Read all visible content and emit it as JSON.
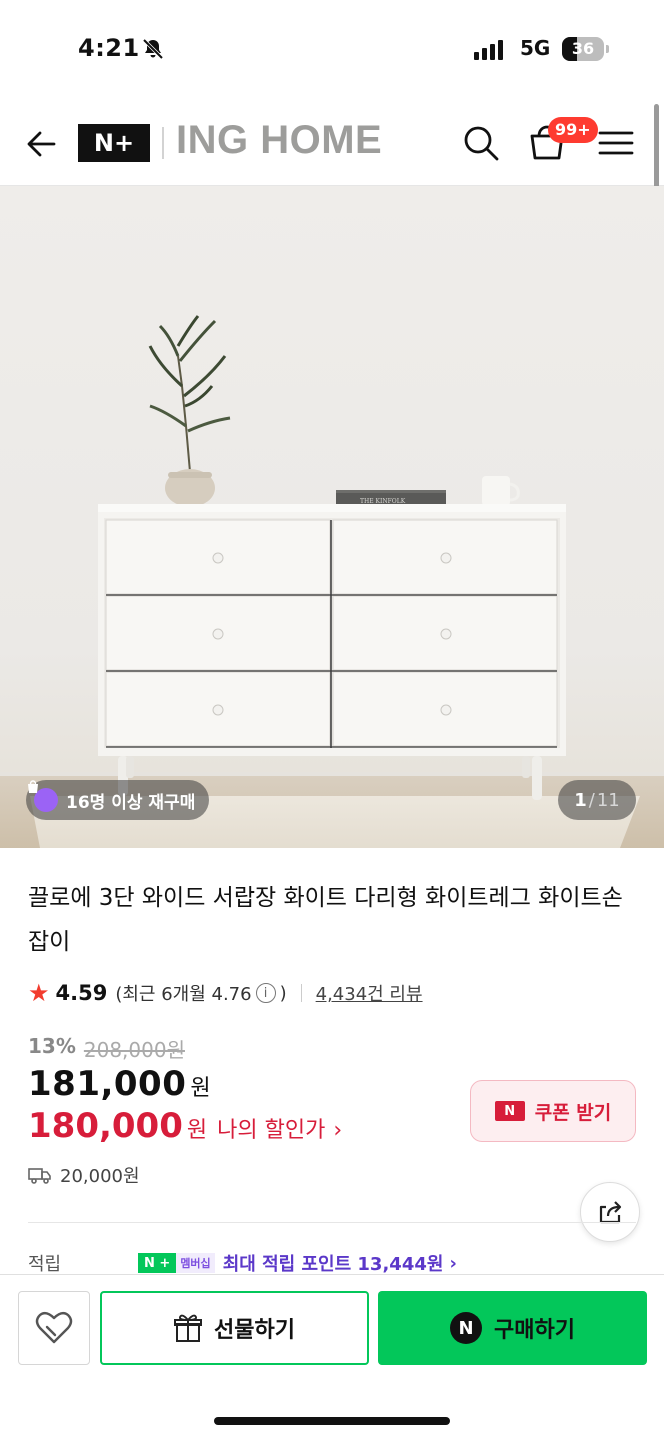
{
  "status": {
    "time": "4:21",
    "network": "5G",
    "battery": "36",
    "battery_level": 0.36
  },
  "header": {
    "logo_text": "N+",
    "brand": "ING HOME",
    "cart_badge": "99+"
  },
  "hero": {
    "repurchase_badge": "16명 이상 재구매",
    "page_current": "1",
    "page_total": "11",
    "book_title": "THE KINFOLK"
  },
  "product": {
    "title": "끌로에 3단 와이드 서랍장 화이트 다리형 화이트레그 화이트손잡이",
    "rating": "4.59",
    "recent_rating": "(최근 6개월 4.76",
    "recent_close": ")",
    "review_count": "4,434건 리뷰",
    "discount_rate": "13%",
    "original_price": "208,000원",
    "price": "181,000",
    "price_unit": "원",
    "my_price": "180,000",
    "my_price_unit": "원",
    "my_price_label": "나의 할인가",
    "coupon_label": "쿠폰 받기",
    "shipping_fee": "20,000원",
    "points_label": "적립",
    "membership_badge_np": "N +",
    "membership_badge_label": "멤버십",
    "points_text": "최대 적립 포인트 13,444원"
  },
  "bottom_bar": {
    "gift_label": "선물하기",
    "buy_label": "구매하기"
  },
  "colors": {
    "naver_green": "#03c75a",
    "price_red": "#d71d3a",
    "badge_red": "#fe3b30"
  }
}
